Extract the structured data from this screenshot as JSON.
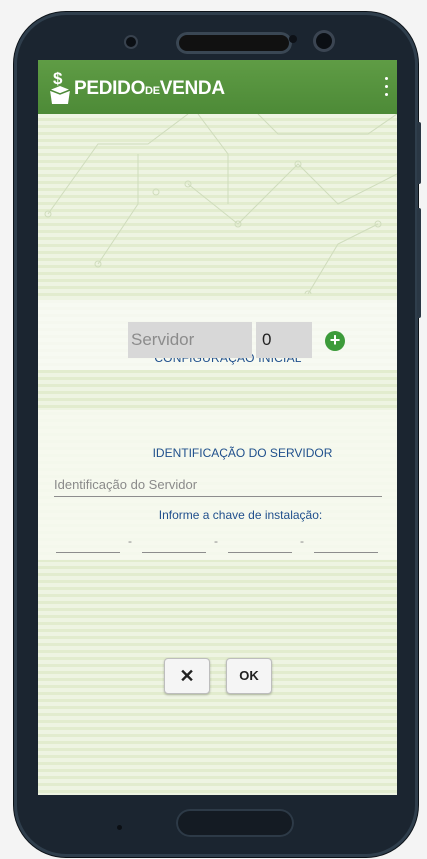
{
  "app": {
    "brand": "PEDIDO",
    "brand_small": "DE",
    "brand_end": "VENDA"
  },
  "config": {
    "title": "CONFIGURAÇÃO INICIAL",
    "servidor_placeholder": "Servidor",
    "port_value": "0",
    "add_symbol": "+"
  },
  "identificacao": {
    "title": "IDENTIFICAÇÃO DO SERVIDOR",
    "placeholder": "Identificação do Servidor",
    "chave_label": "Informe a chave de instalação:",
    "separator": "-"
  },
  "buttons": {
    "cancel_symbol": "✕",
    "ok_label": "OK"
  },
  "colors": {
    "appbar": "#4d8a37",
    "accent_text": "#1f4f8c",
    "add_button": "#3c9b3a"
  }
}
